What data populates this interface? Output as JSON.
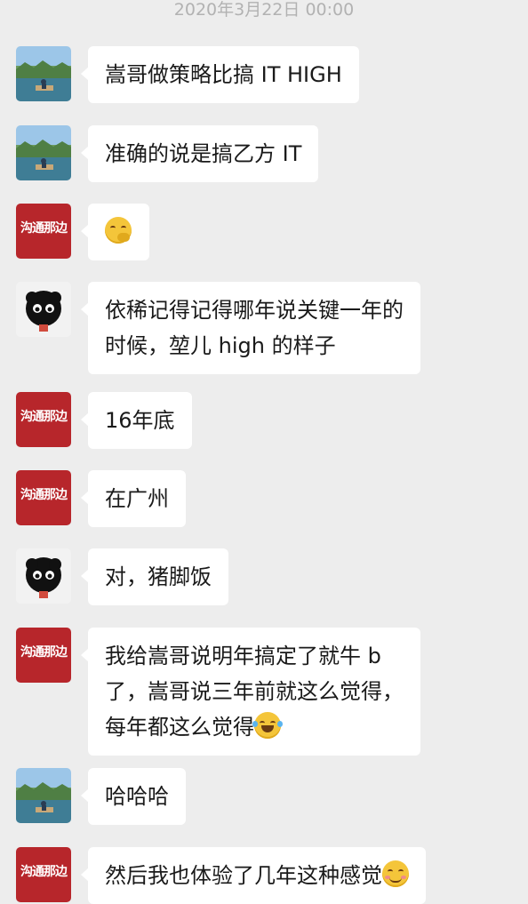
{
  "timestamp": "2020年3月22日 00:00",
  "messages": [
    {
      "sender": "landscape",
      "text": "嵩哥做策略比搞 IT HIGH"
    },
    {
      "sender": "landscape",
      "text": "准确的说是搞乙方 IT"
    },
    {
      "sender": "red_logo",
      "text": "",
      "emoji": "thinking-face"
    },
    {
      "sender": "black_fluff",
      "lines": [
        "依稀记得记得哪年说关键一年的",
        "时候，堃儿 high 的样子"
      ]
    },
    {
      "sender": "red_logo",
      "text": "16年底"
    },
    {
      "sender": "red_logo",
      "text": "在广州"
    },
    {
      "sender": "black_fluff",
      "text": "对，猪脚饭"
    },
    {
      "sender": "red_logo",
      "lines": [
        "我给嵩哥说明年搞定了就牛 b",
        "了，嵩哥说三年前就这么觉得，",
        "每年都这么觉得"
      ],
      "emoji": "tears-of-joy"
    },
    {
      "sender": "landscape",
      "text": "哈哈哈"
    },
    {
      "sender": "red_logo",
      "text": "然后我也体验了几年这种感觉",
      "emoji": "blushing-smile"
    }
  ],
  "avatars": {
    "red_logo_text": "沟通那边"
  },
  "colors": {
    "background": "#ededed",
    "bubble": "#ffffff",
    "red_logo": "#b7262b"
  }
}
